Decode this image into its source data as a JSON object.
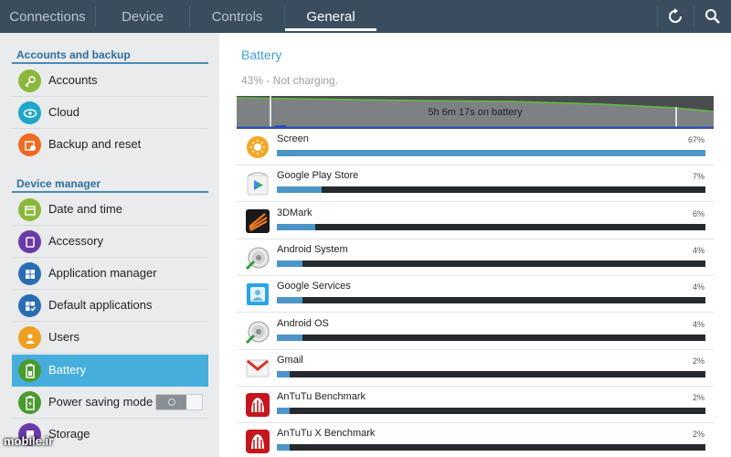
{
  "tabs": [
    {
      "label": "Connections",
      "active": false
    },
    {
      "label": "Device",
      "active": false
    },
    {
      "label": "Controls",
      "active": false
    },
    {
      "label": "General",
      "active": true
    }
  ],
  "top_icons": [
    "refresh-icon",
    "search-icon"
  ],
  "sidebar": {
    "sections": [
      {
        "title": "Accounts and backup",
        "items": [
          {
            "label": "Accounts",
            "icon": "key-icon",
            "color": "#8cb83a"
          },
          {
            "label": "Cloud",
            "icon": "cloud-eye-icon",
            "color": "#1fa6c9"
          },
          {
            "label": "Backup and reset",
            "icon": "backup-reset-icon",
            "color": "#f06a20"
          }
        ]
      },
      {
        "title": "Device manager",
        "items": [
          {
            "label": "Date and time",
            "icon": "calendar-icon",
            "color": "#8cb83a"
          },
          {
            "label": "Accessory",
            "icon": "accessory-icon",
            "color": "#6b3aa8"
          },
          {
            "label": "Application manager",
            "icon": "grid-icon",
            "color": "#2a6db3"
          },
          {
            "label": "Default applications",
            "icon": "default-apps-icon",
            "color": "#2a6db3"
          },
          {
            "label": "Users",
            "icon": "users-icon",
            "color": "#f0a020"
          },
          {
            "label": "Battery",
            "icon": "battery-icon",
            "color": "#4a9a2e",
            "selected": true
          },
          {
            "label": "Power saving mode",
            "icon": "power-saving-icon",
            "color": "#4a9a2e",
            "toggle": "off"
          },
          {
            "label": "Storage",
            "icon": "storage-icon",
            "color": "#6b3aa8"
          }
        ]
      }
    ]
  },
  "battery": {
    "title": "Battery",
    "status": "43% - Not charging.",
    "graph_label": "5h 6m 17s on battery",
    "apps": [
      {
        "name": "Screen",
        "percent": "67%",
        "value": 67,
        "icon": "brightness-icon"
      },
      {
        "name": "Google Play Store",
        "percent": "7%",
        "value": 7,
        "icon": "play-store-icon"
      },
      {
        "name": "3DMark",
        "percent": "6%",
        "value": 6,
        "icon": "3dmark-icon"
      },
      {
        "name": "Android System",
        "percent": "4%",
        "value": 4,
        "icon": "android-system-icon"
      },
      {
        "name": "Google Services",
        "percent": "4%",
        "value": 4,
        "icon": "google-services-icon"
      },
      {
        "name": "Android OS",
        "percent": "4%",
        "value": 4,
        "icon": "android-os-icon"
      },
      {
        "name": "Gmail",
        "percent": "2%",
        "value": 2,
        "icon": "gmail-icon"
      },
      {
        "name": "AnTuTu Benchmark",
        "percent": "2%",
        "value": 2,
        "icon": "antutu-icon"
      },
      {
        "name": "AnTuTu X Benchmark",
        "percent": "2%",
        "value": 2,
        "icon": "antutu-x-icon"
      }
    ]
  },
  "watermark": "mobile.ir"
}
